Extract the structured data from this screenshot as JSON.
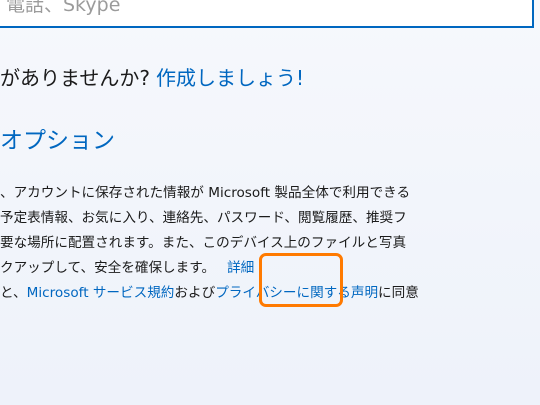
{
  "top_field": {
    "text": "電話、Skype"
  },
  "headline": {
    "prefix": "がありませんか?",
    "create_link": "作成しましょう!"
  },
  "section": {
    "title": "オプション"
  },
  "body": {
    "line1": "、アカウントに保存された情報が Microsoft 製品全体で利用できる",
    "line2": "予定表情報、お気に入り、連絡先、パスワード、閲覧履歴、推奨フ",
    "line3": "要な場所に配置されます。また、このデバイス上のファイルと写真",
    "line4_text": "クアップして、安全を確保します。",
    "details_link": "詳細",
    "line5_prefix": "と、",
    "services_link": "Microsoft サービス規約",
    "and_text": "および",
    "privacy_link": "プライバシーに関する声明",
    "line5_suffix": "に同意"
  },
  "colors": {
    "accent": "#0067c0",
    "focus_ring": "#ff7a00"
  }
}
